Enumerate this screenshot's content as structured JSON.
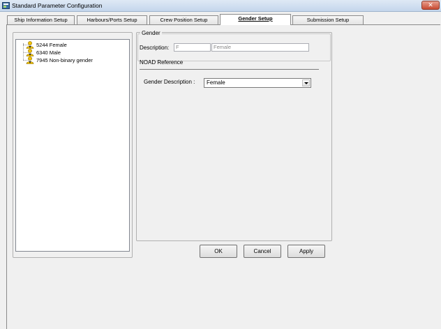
{
  "window": {
    "title": "Standard Parameter Configuration",
    "close_glyph": "✕",
    "app_icon": "app-icon"
  },
  "tabs": [
    {
      "label": "Ship Information Setup",
      "active": false
    },
    {
      "label": "Harbours/Ports Setup",
      "active": false
    },
    {
      "label": "Crew Position Setup",
      "active": false
    },
    {
      "label": "Gender Setup",
      "active": true
    },
    {
      "label": "Submission Setup",
      "active": false
    }
  ],
  "tree": {
    "items": [
      {
        "label": "5244 Female",
        "icon": "person-icon"
      },
      {
        "label": "6340 Male",
        "icon": "person-icon"
      },
      {
        "label": "7945 Non-binary gender",
        "icon": "person-icon"
      }
    ]
  },
  "gender_group": {
    "legend": "Gender",
    "description_label": "Description:",
    "code_value": "F",
    "description_value": "Female"
  },
  "noad": {
    "title": "NOAD Reference",
    "gender_description_label": "Gender Description :",
    "gender_description_value": "Female"
  },
  "buttons": {
    "ok": "OK",
    "cancel": "Cancel",
    "apply": "Apply"
  },
  "colors": {
    "titlebar": "#c4d6ec",
    "close_button": "#c74a32",
    "panel_background": "#f0f0f0",
    "icon_yellow": "#f2c200"
  }
}
